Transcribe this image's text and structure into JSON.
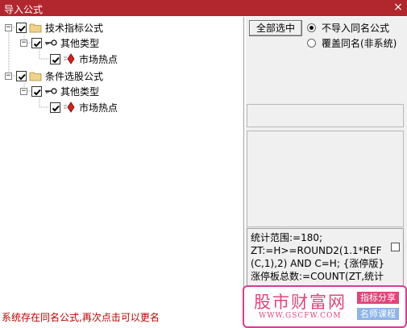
{
  "window": {
    "title": "导入公式",
    "close_glyph": "×"
  },
  "tree": {
    "nodes": [
      {
        "label": "技术指标公式",
        "icon": "folder-icon",
        "checked": true,
        "expanded": true
      },
      {
        "label": "其他类型",
        "icon": "key-icon",
        "checked": true,
        "expanded": true
      },
      {
        "label": "市场热点",
        "icon": "diamond-icon",
        "checked": true
      },
      {
        "label": "条件选股公式",
        "icon": "folder-icon",
        "checked": true,
        "expanded": true
      },
      {
        "label": "其他类型",
        "icon": "key-icon",
        "checked": true,
        "expanded": true
      },
      {
        "label": "市场热点",
        "icon": "diamond-icon",
        "checked": true
      }
    ]
  },
  "options": {
    "select_all_label": "全部选中",
    "radio_skip_label": "不导入同名公式",
    "radio_overwrite_label": "覆盖同名(非系统)",
    "selected": "不导入同名公式"
  },
  "formula": {
    "text": "统计范围:=180;\nZT:=H>=ROUND2(1.1*REF(C,1),2) AND C=H; {涨停版}\n涨停板总数:=COUNT(ZT,统计"
  },
  "status_message": "系统存在同名公式,再次点击可以更名",
  "watermark": {
    "site_name": "股市财富网",
    "url": "WWW.GSCFW.COM",
    "tag1": "指标分享",
    "tag2": "名师课程"
  },
  "colors": {
    "titlebar": "#b1272d",
    "status_text": "#c00000",
    "watermark": "#e0457a"
  }
}
